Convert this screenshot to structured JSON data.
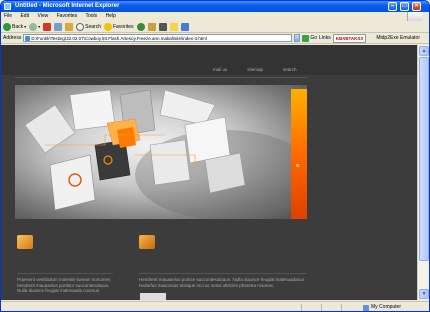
{
  "window": {
    "title": "Untitled - Microsoft Internet Explorer"
  },
  "menubar": {
    "items": [
      "File",
      "Edit",
      "View",
      "Favorites",
      "Tools",
      "Help"
    ]
  },
  "toolbar": {
    "back_label": "Back",
    "search_label": "Search",
    "favorites_label": "Favorites"
  },
  "addressbar": {
    "label": "Address",
    "value": "D:\\Funtik\\Testing\\32.02.07\\Cowboy.93.Flash.Artesoy.Freeze.ann.makal\\site\\index-3.html",
    "go_label": "Go",
    "links_label": "Links",
    "extra_label": "KBXBTAKSX",
    "emulator_label": "Midp2Exe Emulator"
  },
  "site": {
    "nav": [
      "mail us",
      "sitemap",
      "search"
    ],
    "orange_bar_glyph": "o",
    "left_col_text": "Praesent vestibulum molestie lunean nonumes hendrerit mauaselus porttitor succonterulauus. Nulla duuisce feugiat malesuada cuursus.",
    "right_col_text": "Hendrerit mauaselus portice succontesulauus. Nulla duuisce feugiat malesuadaruo hedarfus mascenas tristique orci ac sensi ultricies pharetra maonec."
  },
  "statusbar": {
    "zone_label": "My Computer"
  },
  "colors": {
    "xp_titlebar": "#0a5be8",
    "site_bg": "#3c3c3c",
    "accent_orange": "#ff6a00"
  }
}
